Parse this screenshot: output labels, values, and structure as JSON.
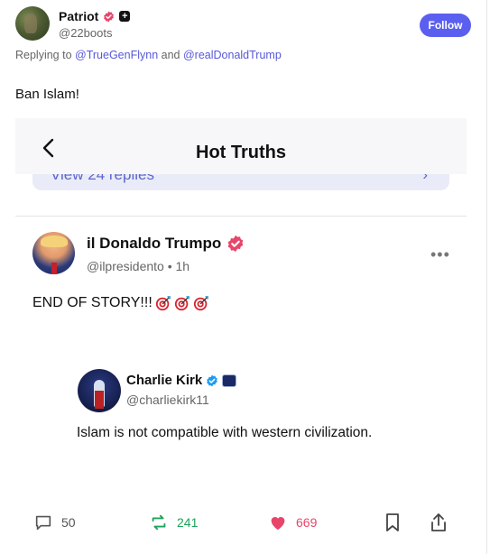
{
  "author": {
    "display_name": "Patriot",
    "handle": "@22boots",
    "follow_label": "Follow"
  },
  "replying": {
    "prefix": "Replying to",
    "mention_1": "@TrueGenFlynn",
    "joiner": "and",
    "mention_2": "@realDonaldTrump"
  },
  "post": {
    "text": "Ban Islam!"
  },
  "embed": {
    "title": "Hot Truths",
    "view_replies_label": "View 24 replies",
    "quoted": {
      "display_name": "il Donaldo Trumpo",
      "handle_time": "@ilpresidento • 1h",
      "text": "END OF STORY!!!",
      "emoji_icon": "direct-hit-target",
      "emoji_count": 3,
      "nested": {
        "display_name": "Charlie Kirk",
        "handle": "@charliekirk11",
        "text": "Islam is not compatible with western civilization."
      }
    },
    "actions": {
      "replies": "50",
      "retruths": "241",
      "likes": "669"
    }
  },
  "colors": {
    "accent": "#5b5ff0",
    "mention": "#5658d8",
    "retruth": "#1ea35a",
    "like": "#e8456a",
    "verified": "#e8456a"
  }
}
